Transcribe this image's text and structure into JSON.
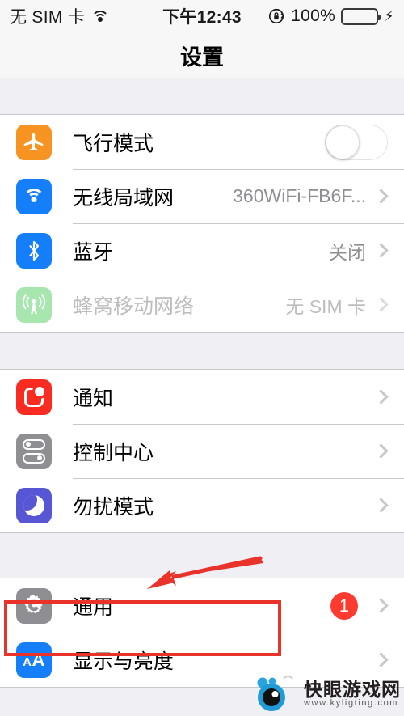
{
  "status_bar": {
    "carrier": "无 SIM 卡",
    "wifi_icon": "wifi-icon",
    "time": "下午12:43",
    "rotation_lock_icon": "rotation-lock-icon",
    "battery_percent": "100%",
    "charging_icon": "lightning-bolt-icon",
    "battery_fill_percent": 100,
    "battery_color": "#4CD964"
  },
  "nav": {
    "title": "设置"
  },
  "groups": [
    {
      "rows": [
        {
          "name": "airplane-mode",
          "icon": "airplane-icon",
          "icon_class": "ic-airplane",
          "label": "飞行模式",
          "accessory": "toggle",
          "toggle_on": false
        },
        {
          "name": "wifi",
          "icon": "wifi-icon",
          "icon_class": "ic-wifi",
          "label": "无线局域网",
          "value": "360WiFi-FB6F...",
          "accessory": "chevron"
        },
        {
          "name": "bluetooth",
          "icon": "bluetooth-icon",
          "icon_class": "ic-bt",
          "label": "蓝牙",
          "value": "关闭",
          "accessory": "chevron"
        },
        {
          "name": "cellular",
          "icon": "cellular-antenna-icon",
          "icon_class": "ic-cell",
          "label": "蜂窝移动网络",
          "value": "无 SIM 卡",
          "accessory": "chevron",
          "disabled": true
        }
      ]
    },
    {
      "rows": [
        {
          "name": "notifications",
          "icon": "notification-icon",
          "icon_class": "ic-notif",
          "label": "通知",
          "accessory": "chevron"
        },
        {
          "name": "control-center",
          "icon": "control-center-icon",
          "icon_class": "ic-cc",
          "label": "控制中心",
          "accessory": "chevron"
        },
        {
          "name": "do-not-disturb",
          "icon": "moon-icon",
          "icon_class": "ic-dnd",
          "label": "勿扰模式",
          "accessory": "chevron"
        }
      ]
    },
    {
      "rows": [
        {
          "name": "general",
          "icon": "gear-icon",
          "icon_class": "ic-general",
          "label": "通用",
          "badge": "1",
          "accessory": "chevron",
          "highlighted": true
        },
        {
          "name": "display-brightness",
          "icon": "aa-text-size-icon",
          "icon_class": "ic-display",
          "label": "显示与亮度",
          "accessory": "chevron"
        }
      ]
    }
  ],
  "annotations": {
    "highlight_color": "#E8322A",
    "box_target": "通用",
    "arrow": "red-arrow-pointing-to-general-row"
  },
  "watermark": {
    "site_name": "快眼游戏网",
    "site_url": "www.kyligting.com",
    "logo_icon": "eye-mascot-logo-icon"
  }
}
